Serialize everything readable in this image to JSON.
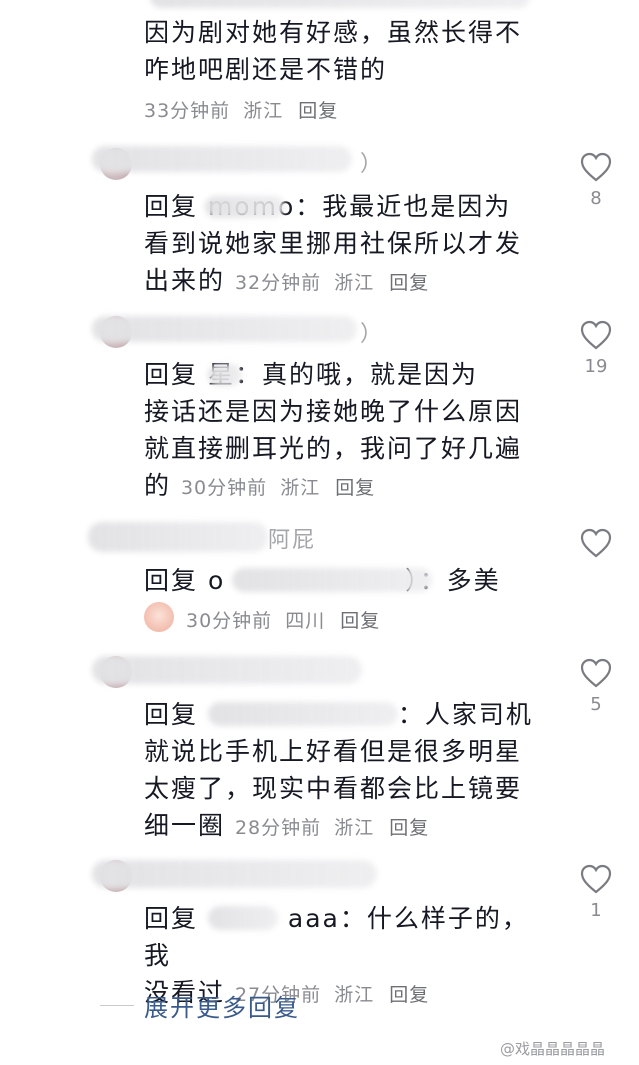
{
  "top_comment": {
    "line1": "因为剧对她有好感，虽然长得不",
    "line2": "咋地吧剧还是不错的",
    "time": "33分钟前",
    "location": "浙江",
    "reply": "回复"
  },
  "comments": [
    {
      "name_visible": "）",
      "text_l1": "回复 momo：我最近也是因为",
      "text_l2": "看到说她家里挪用社保所以才发",
      "text_l3": "出来的",
      "time": "32分钟前",
      "location": "浙江",
      "reply": "回复",
      "likes": "8"
    },
    {
      "name_visible": "）",
      "text_l1": "回复 星：真的哦，就是因为",
      "text_l2": "接话还是因为接她晚了什么原因",
      "text_l3": "就直接删耳光的，我问了好几遍",
      "text_l4": "的",
      "time": "30分钟前",
      "location": "浙江",
      "reply": "回复",
      "likes": "19"
    },
    {
      "name_visible": "阿屁",
      "text_l1": "回复 o",
      "text_l1_end": "）：多美",
      "time": "30分钟前",
      "location": "四川",
      "reply": "回复",
      "likes": ""
    },
    {
      "name_visible": "",
      "text_l1": "回复",
      "text_l1_end": "：人家司机",
      "text_l2": "就说比手机上好看但是很多明星",
      "text_l3": "太瘦了，现实中看都会比上镜要",
      "text_l4": "细一圈",
      "time": "28分钟前",
      "location": "浙江",
      "reply": "回复",
      "likes": "5"
    },
    {
      "name_visible": "",
      "text_l1": "回复",
      "text_l1_end": "aaa：什么样子的，我",
      "text_l2": "没看过",
      "time": "27分钟前",
      "location": "浙江",
      "reply": "回复",
      "likes": "1"
    }
  ],
  "expand_more": "展开更多回复",
  "watermark": "@戏晶晶晶晶晶"
}
